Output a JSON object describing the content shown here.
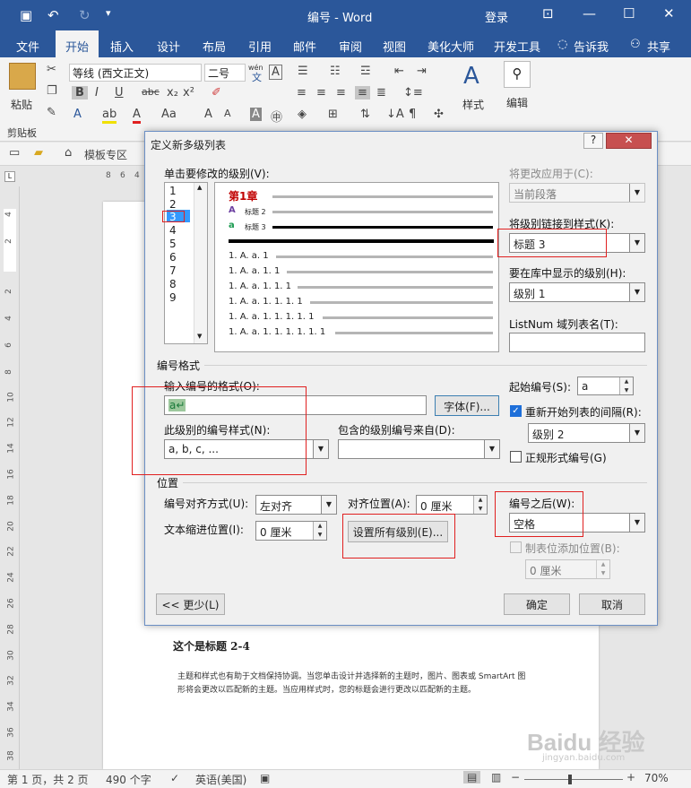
{
  "window": {
    "title": "编号 - Word",
    "login": "登录",
    "controls": [
      "—",
      "☐",
      "✕"
    ]
  },
  "ribbon_tabs": [
    "文件",
    "开始",
    "插入",
    "设计",
    "布局",
    "引用",
    "邮件",
    "审阅",
    "视图",
    "美化大师",
    "开发工具",
    "告诉我",
    "共享"
  ],
  "ribbon": {
    "paste": "粘贴",
    "clipboard": "剪贴板",
    "font_name": "等线 (西文正文)",
    "font_size": "二号",
    "styles": "样式",
    "edit": "编辑",
    "wen_label": "wén",
    "wen_char": "文"
  },
  "navbar": {
    "template_label": "模板专区"
  },
  "ruler": {
    "numbers": [
      "8",
      "6",
      "4"
    ],
    "v_numbers": [
      "4",
      "2",
      "2",
      "4",
      "6",
      "8",
      "10",
      "12",
      "14",
      "16",
      "18",
      "20",
      "22",
      "24",
      "26",
      "28",
      "30",
      "32",
      "34",
      "36",
      "38"
    ]
  },
  "document": {
    "heading": "这个是标题 2-4",
    "body": "主题和样式也有助于文档保持协调。当您单击设计并选择新的主题时，图片、图表或 SmartArt 图形将会更改以匹配新的主题。当应用样式时，您的标题会进行更改以匹配新的主题。"
  },
  "statusbar": {
    "page": "第 1 页，共 2 页",
    "words": "490 个字",
    "language": "英语(美国)",
    "zoom": "70%"
  },
  "dialog": {
    "title": "定义新多级列表",
    "help": "?",
    "close": "✕",
    "level_label": "单击要修改的级别(V):",
    "levels": [
      "1",
      "2",
      "3",
      "4",
      "5",
      "6",
      "7",
      "8",
      "9"
    ],
    "selected_level": "3",
    "preview": {
      "chapter": "第1章",
      "a_upper": "A",
      "a_lower": "a",
      "title2": "标题 2",
      "title3": "标题 3",
      "rows": [
        "1. A. a. 1",
        "1. A. a. 1. 1",
        "1. A. a. 1. 1. 1",
        "1. A. a. 1. 1. 1. 1",
        "1. A. a. 1. 1. 1. 1. 1",
        "1. A. a. 1. 1. 1. 1. 1. 1"
      ]
    },
    "apply_to_label": "将更改应用于(C):",
    "apply_to_value": "当前段落",
    "link_style_label": "将级别链接到样式(K):",
    "link_style_value": "标题 3",
    "gallery_level_label": "要在库中显示的级别(H):",
    "gallery_level_value": "级别 1",
    "listnum_label": "ListNum 域列表名(T):",
    "listnum_value": "",
    "number_format_group": "编号格式",
    "enter_format_label": "输入编号的格式(O):",
    "enter_format_value": "a↵",
    "font_button": "字体(F)...",
    "number_style_label": "此级别的编号样式(N):",
    "number_style_value": "a, b, c, ...",
    "include_from_label": "包含的级别编号来自(D):",
    "include_from_value": "",
    "start_at_label": "起始编号(S):",
    "start_at_value": "a",
    "restart_label": "重新开始列表的间隔(R):",
    "restart_checked": "✓",
    "restart_value": "级别 2",
    "legal_label": "正规形式编号(G)",
    "position_group": "位置",
    "align_label": "编号对齐方式(U):",
    "align_value": "左对齐",
    "aligned_at_label": "对齐位置(A):",
    "aligned_at_value": "0 厘米",
    "indent_label": "文本缩进位置(I):",
    "indent_value": "0 厘米",
    "set_all_button": "设置所有级别(E)...",
    "follow_label": "编号之后(W):",
    "follow_value": "空格",
    "tab_stop_label": "制表位添加位置(B):",
    "tab_stop_value": "0 厘米",
    "less_button": "<< 更少(L)",
    "ok_button": "确定",
    "cancel_button": "取消"
  },
  "watermark": "Baidu 经验",
  "watermark_url": "jingyan.baidu.com",
  "colors": {
    "word_blue": "#2b579a",
    "highlight_red": "#e02020",
    "chapter_red": "#c00000",
    "selection_blue": "#3399ff"
  }
}
